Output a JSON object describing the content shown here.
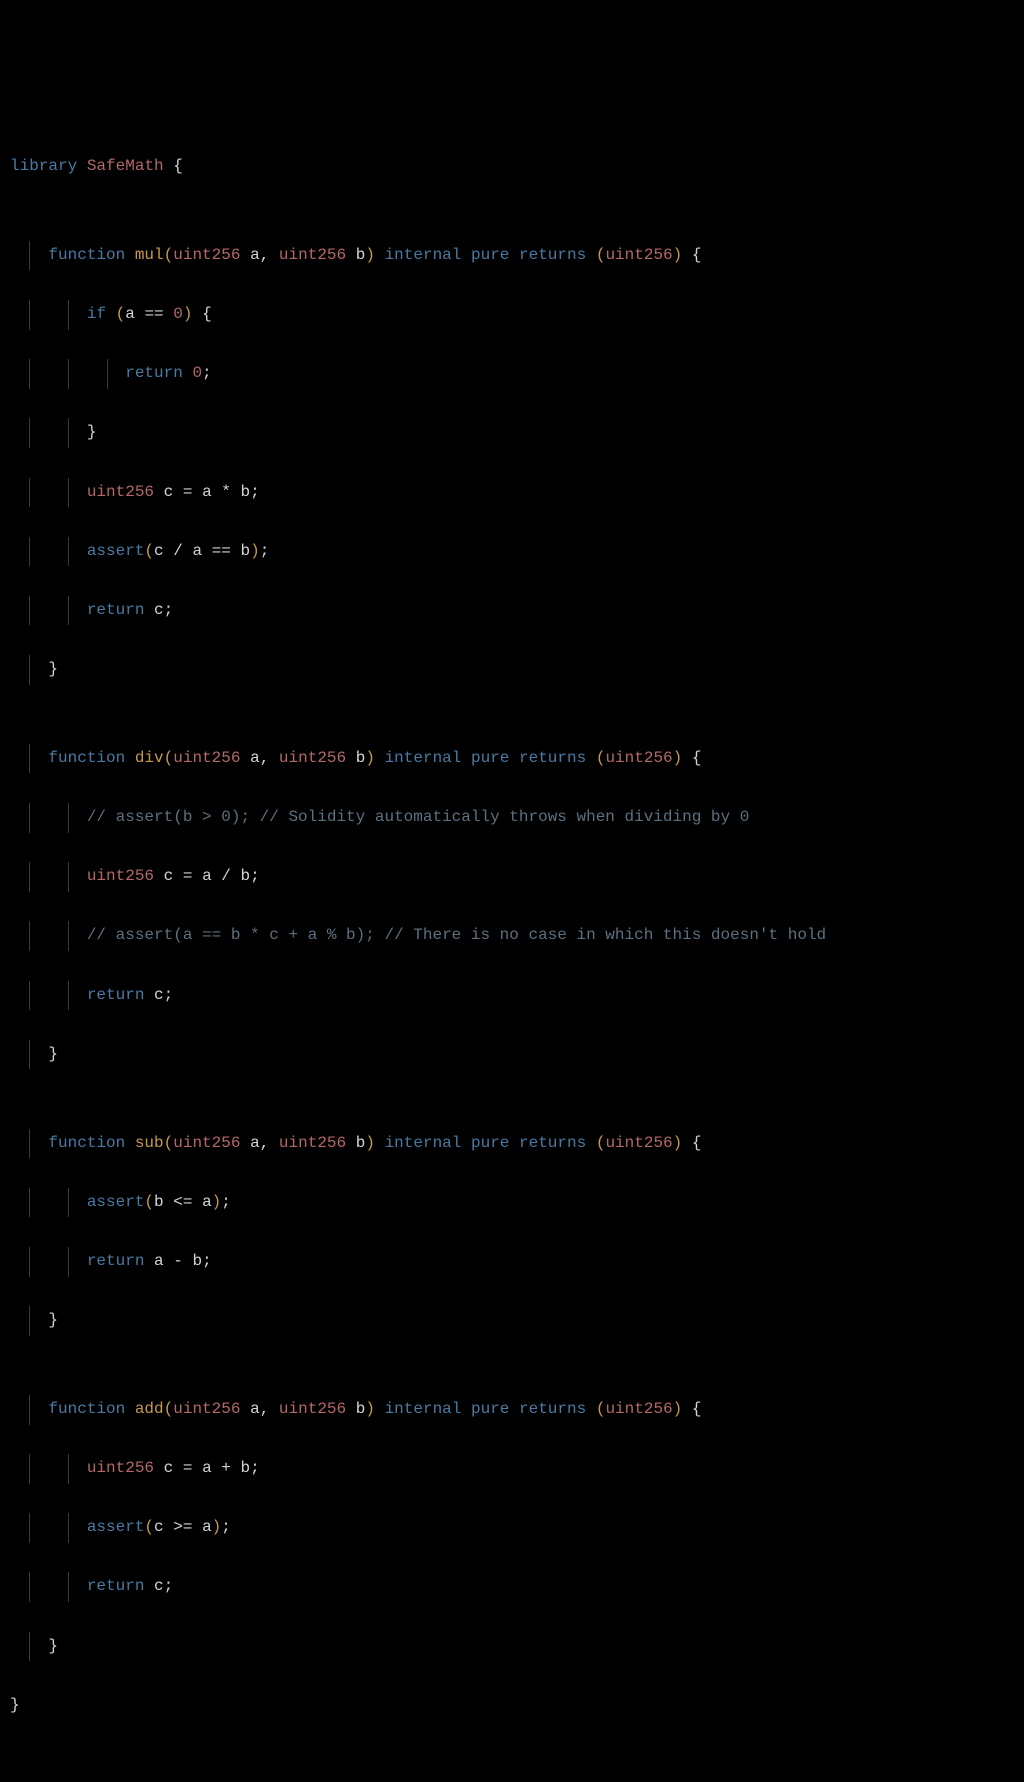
{
  "code": {
    "kw": {
      "library": "library",
      "function": "function",
      "internal": "internal",
      "pure": "pure",
      "returns": "returns",
      "if": "if",
      "return": "return"
    },
    "types": {
      "SafeMath": "SafeMath",
      "uint256": "uint256"
    },
    "funcs": {
      "mul": "mul",
      "div": "div",
      "sub": "sub",
      "add": "add"
    },
    "builtin": {
      "assert": "assert"
    },
    "vars": {
      "a": "a",
      "b": "b",
      "c": "c"
    },
    "nums": {
      "zero": "0"
    },
    "comments": {
      "div1": "// assert(b > 0); // Solidity automatically throws when dividing by 0",
      "div2": "// assert(a == b * c + a % b); // There is no case in which this doesn't hold"
    },
    "sym": {
      "openBrace": "{",
      "closeBrace": "}",
      "openParen": "(",
      "closeParen": ")",
      "comma": ",",
      "semi": ";",
      "eq": "=",
      "eqeq": "==",
      "lte": "<=",
      "gte": ">=",
      "star": "*",
      "slash": "/",
      "plus": "+",
      "minus": "-"
    }
  }
}
